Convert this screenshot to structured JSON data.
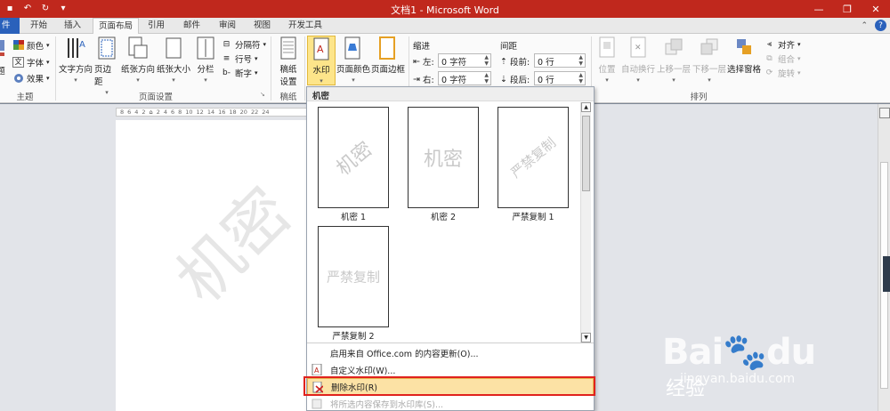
{
  "window": {
    "title": "文档1 - Microsoft Word",
    "qat": [
      "save-icon",
      "undo-icon",
      "redo-icon",
      "customize-qat-icon"
    ]
  },
  "tabs": {
    "file": "件",
    "items": [
      "开始",
      "插入",
      "页面布局",
      "引用",
      "邮件",
      "审阅",
      "视图",
      "开发工具"
    ],
    "active": "页面布局"
  },
  "ribbon": {
    "theme": {
      "theme_label": "题",
      "colors": "颜色",
      "fonts": "字体",
      "effects": "效果",
      "group_label": "主题"
    },
    "page_setup": {
      "text_direction": "文字方向",
      "margins": "页边距",
      "orientation": "纸张方向",
      "size": "纸张大小",
      "columns": "分栏",
      "breaks": "分隔符",
      "line_numbers": "行号",
      "hyphenation": "断字",
      "group_label": "页面设置"
    },
    "draft": {
      "label_line1": "稿纸",
      "label_line2": "设置",
      "group_label": "稿纸"
    },
    "page_background": {
      "watermark": "水印",
      "page_color": "页面颜色",
      "page_border": "页面边框"
    },
    "paragraph": {
      "indent_title": "缩进",
      "left": "左:",
      "left_value": "0 字符",
      "right": "右:",
      "right_value": "0 字符",
      "spacing_title": "间距",
      "before": "段前:",
      "before_value": "0 行",
      "after": "段后:",
      "after_value": "0 行"
    },
    "arrange": {
      "position": "位置",
      "wrap": "自动换行",
      "forward": "上移一层",
      "backward": "下移一层",
      "selection_pane": "选择窗格",
      "align": "对齐",
      "group": "组合",
      "rotate": "旋转",
      "group_label": "排列"
    }
  },
  "dropdown": {
    "section_header": "机密",
    "gallery": [
      {
        "label": "机密 1",
        "watermark": "机密"
      },
      {
        "label": "机密 2",
        "watermark": "机密"
      },
      {
        "label": "严禁复制 1",
        "watermark": "严禁复制"
      },
      {
        "label": "严禁复制 2",
        "watermark": "严禁复制"
      }
    ],
    "menu": [
      {
        "label": "启用来自 Office.com 的内容更新(O)...",
        "enabled": true
      },
      {
        "label": "自定义水印(W)...",
        "enabled": true
      },
      {
        "label": "删除水印(R)",
        "enabled": true,
        "highlighted": true
      },
      {
        "label": "将所选内容保存到水印库(S)...",
        "enabled": false
      }
    ]
  },
  "document": {
    "ruler_ticks": [
      "8",
      "6",
      "4",
      "2",
      "",
      "2",
      "4",
      "6",
      "8",
      "10",
      "12",
      "14",
      "16",
      "18",
      "20",
      "22",
      "24"
    ],
    "watermark_text": "机密"
  },
  "overlay": {
    "brand": "Bai",
    "brand_tail": "du",
    "jingyan": "经验",
    "url": "jingyan.baidu.com"
  },
  "colors": {
    "titlebar": "#c0281d",
    "file_tab": "#2a61bb",
    "highlight": "#fce2a5",
    "callout_box": "#e0221d"
  }
}
